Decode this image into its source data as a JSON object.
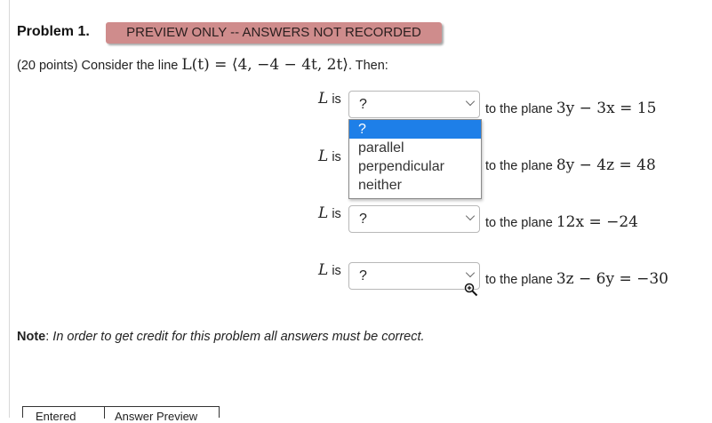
{
  "problem": {
    "title": "Problem 1.",
    "badge": "PREVIEW ONLY -- ANSWERS NOT RECORDED",
    "intro": "(20 points) Consider the line ",
    "line_expr": "L(t) = ⟨4, −4 − 4t, 2t⟩",
    "intro_end": ". Then:"
  },
  "rows": [
    {
      "label_var": "L",
      "label_text": " is",
      "select_value": "?",
      "plane_prefix": "to the plane ",
      "plane_eq": "3y − 3x = 15"
    },
    {
      "label_var": "L",
      "label_text": " is",
      "select_value": "?",
      "plane_prefix": "to the plane ",
      "plane_eq": "8y − 4z = 48"
    },
    {
      "label_var": "L",
      "label_text": " is",
      "select_value": "?",
      "plane_prefix": "to the plane ",
      "plane_eq": "12x = −24"
    },
    {
      "label_var": "L",
      "label_text": " is",
      "select_value": "?",
      "plane_prefix": "to the plane ",
      "plane_eq": "3z − 6y = −30"
    }
  ],
  "dropdown": {
    "options": [
      "?",
      "parallel",
      "perpendicular",
      "neither"
    ],
    "highlighted": "?"
  },
  "note": {
    "label": "Note",
    "sep": ": ",
    "text": "In order to get credit for this problem all answers must be correct."
  },
  "bottom": {
    "btn1": "Entered",
    "btn2": "Answer Preview"
  },
  "icons": {
    "zoom": "zoom-in-icon",
    "chevron": "chevron-down-icon"
  },
  "colors": {
    "badge_bg": "#cf8c8c",
    "highlight": "#1e7fe8"
  }
}
